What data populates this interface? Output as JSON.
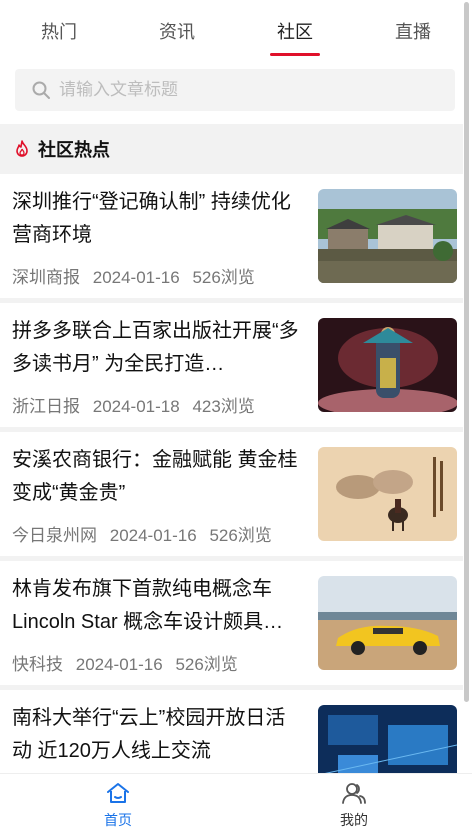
{
  "tabs": [
    {
      "label": "热门",
      "active": false
    },
    {
      "label": "资讯",
      "active": false
    },
    {
      "label": "社区",
      "active": true
    },
    {
      "label": "直播",
      "active": false
    }
  ],
  "search": {
    "placeholder": "请输入文章标题",
    "icon": "search-icon"
  },
  "section": {
    "title": "社区热点",
    "icon": "flame-icon",
    "icon_color": "#e0102a"
  },
  "news": [
    {
      "title": "深圳推行“登记确认制” 持续优化营商环境",
      "source": "深圳商报",
      "date": "2024-01-16",
      "views": "526浏览",
      "image": "village-photo"
    },
    {
      "title": "拼多多联合上百家出版社开展“多多读书月” 为全民打造…",
      "source": "浙江日报",
      "date": "2024-01-18",
      "views": "423浏览",
      "image": "stage-performance-photo"
    },
    {
      "title": "安溪农商银行：金融赋能 黄金桂变成“黄金贵”",
      "source": "今日泉州网",
      "date": "2024-01-16",
      "views": "526浏览",
      "image": "ink-painting-horses"
    },
    {
      "title": "林肯发布旗下首款纯电概念车 Lincoln Star 概念车设计颇具…",
      "source": "快科技",
      "date": "2024-01-16",
      "views": "526浏览",
      "image": "yellow-car-beach"
    },
    {
      "title": "南科大举行“云上”校园开放日活动 近120万人线上交流",
      "source": "",
      "date": "",
      "views": "",
      "image": "blue-tech-screen"
    }
  ],
  "bottom_nav": [
    {
      "label": "首页",
      "icon": "home-icon",
      "active": true
    },
    {
      "label": "我的",
      "icon": "profile-icon",
      "active": false
    }
  ],
  "colors": {
    "accent": "#e0102a",
    "active_nav": "#1a73e8"
  }
}
